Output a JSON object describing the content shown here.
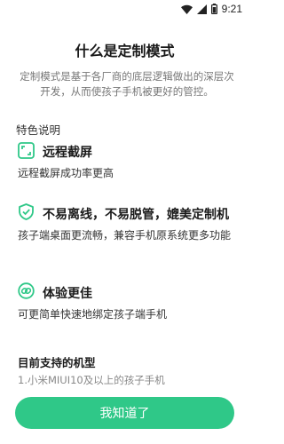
{
  "status_bar": {
    "time": "9:21",
    "icons": [
      "wifi-icon",
      "cellular-signal-icon",
      "battery-icon"
    ]
  },
  "dialog": {
    "title": "什么是定制模式",
    "intro": "定制模式是基于各厂商的底层逻辑做出的深层次开发，从而使孩子手机被更好的管控。",
    "section_label": "特色说明",
    "features": [
      {
        "icon": "screenshot-icon",
        "title": "远程截屏",
        "desc": "远程截屏成功率更高"
      },
      {
        "icon": "shield-check-icon",
        "title": "不易离线，不易脱管，媲美定制机",
        "desc": "孩子端桌面更流畅，兼容手机原系统更多功能"
      },
      {
        "icon": "link-icon",
        "title": "体验更佳",
        "desc": "可更简单快速地绑定孩子端手机"
      }
    ],
    "models_title": "目前支持的机型",
    "models": [
      "1.小米MIUI10及以上的孩子手机"
    ],
    "confirm_label": "我知道了"
  },
  "colors": {
    "accent": "#2fc888",
    "icon_green": "#2fc888"
  }
}
